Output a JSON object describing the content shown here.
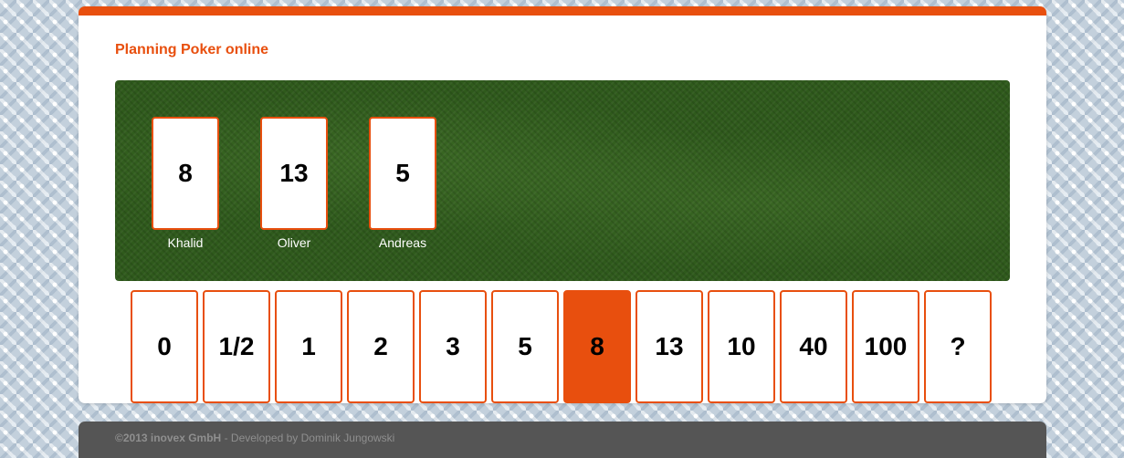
{
  "header": {
    "title": "Planning Poker online"
  },
  "table": {
    "players": [
      {
        "name": "Khalid",
        "vote": "8"
      },
      {
        "name": "Oliver",
        "vote": "13"
      },
      {
        "name": "Andreas",
        "vote": "5"
      }
    ]
  },
  "deck": {
    "cards": [
      "0",
      "1/2",
      "1",
      "2",
      "3",
      "5",
      "8",
      "13",
      "10",
      "40",
      "100",
      "?"
    ],
    "selected": "8"
  },
  "footer": {
    "copyright": "©2013 inovex GmbH",
    "developer": " - Developed by Dominik Jungowski"
  },
  "colors": {
    "accent": "#e84f0e",
    "felt": "#2f5a1c",
    "footer": "#555555"
  }
}
